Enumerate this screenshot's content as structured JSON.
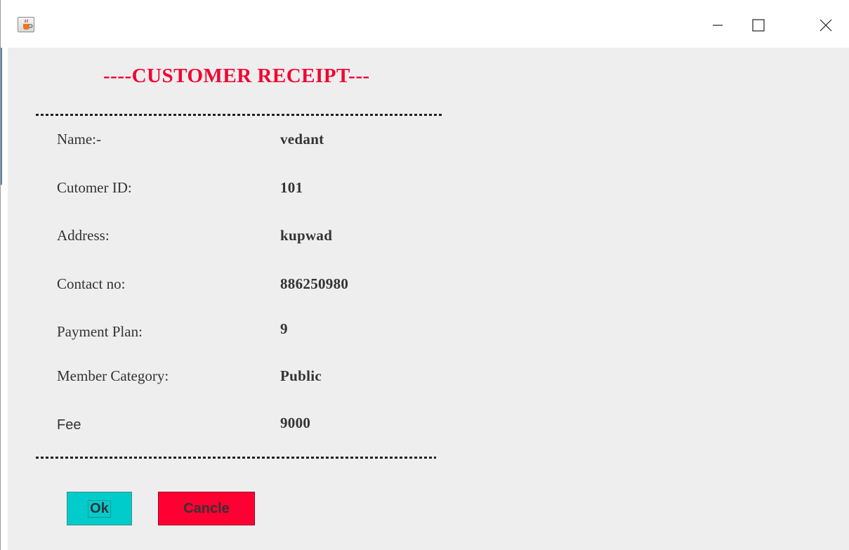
{
  "window": {
    "app_icon": "java-coffee-icon",
    "controls": {
      "minimize": "minimize-icon",
      "maximize": "maximize-icon",
      "close": "close-icon"
    }
  },
  "receipt": {
    "title": "----CUSTOMER RECEIPT---",
    "title_color": "#f20533",
    "fields": [
      {
        "label": "Name:-",
        "value": "vedant"
      },
      {
        "label": "Cutomer ID:",
        "value": "101"
      },
      {
        "label": "Address:",
        "value": "kupwad"
      },
      {
        "label": "Contact no:",
        "value": "886250980"
      },
      {
        "label": "Payment Plan:",
        "value": "9"
      },
      {
        "label": "Member Category:",
        "value": "Public"
      },
      {
        "label": "Fee",
        "value": "9000"
      }
    ]
  },
  "buttons": {
    "ok_label": "Ok",
    "ok_color": "#00cccc",
    "cancel_label": "Cancle",
    "cancel_color": "#ff0033"
  }
}
